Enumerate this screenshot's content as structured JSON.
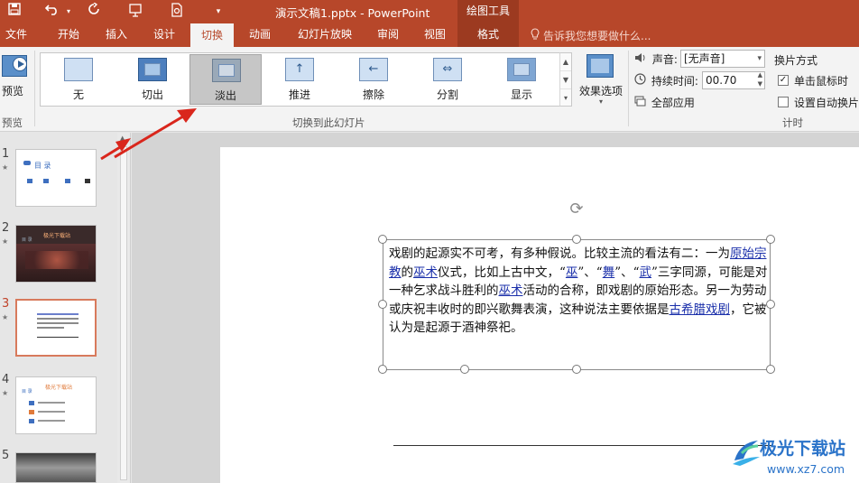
{
  "title_bar": {
    "document_title": "演示文稿1.pptx - PowerPoint",
    "context_label": "绘图工具",
    "icons": [
      "save-icon",
      "undo-icon",
      "redo-icon",
      "present-from-start-icon",
      "print-preview-icon",
      "customize-quick-access-icon"
    ]
  },
  "tabs": [
    {
      "label": "文件"
    },
    {
      "label": "开始"
    },
    {
      "label": "插入"
    },
    {
      "label": "设计"
    },
    {
      "label": "切换",
      "active": true
    },
    {
      "label": "动画"
    },
    {
      "label": "幻灯片放映"
    },
    {
      "label": "审阅"
    },
    {
      "label": "视图"
    },
    {
      "label": "格式",
      "contextual": true
    }
  ],
  "tell_me": "告诉我您想要做什么...",
  "ribbon": {
    "preview": {
      "button_label": "预览",
      "group_label": "预览"
    },
    "transitions_group_label": "切换到此幻灯片",
    "transitions": [
      {
        "label": "无"
      },
      {
        "label": "切出"
      },
      {
        "label": "淡出",
        "selected": true
      },
      {
        "label": "推进"
      },
      {
        "label": "擦除"
      },
      {
        "label": "分割"
      },
      {
        "label": "显示"
      }
    ],
    "effect_options_label": "效果选项",
    "timing": {
      "sound_label": "声音:",
      "sound_value": "[无声音]",
      "duration_label": "持续时间:",
      "duration_value": "00.70",
      "apply_all_label": "全部应用",
      "advance_heading": "换片方式",
      "on_click_label": "单击鼠标时",
      "on_click_checked": true,
      "auto_after_label": "设置自动换片时",
      "auto_after_checked": false,
      "group_label": "计时"
    }
  },
  "slides": [
    {
      "number": "1",
      "thumb_title": "目    录"
    },
    {
      "number": "2",
      "thumb_title": "极光下载站"
    },
    {
      "number": "3",
      "current": true
    },
    {
      "number": "4",
      "thumb_title": "极光下载站",
      "thumb_subtitle": "目 录"
    },
    {
      "number": "5"
    }
  ],
  "textbox": {
    "segments": [
      {
        "text": "戏剧的起源实不可考，有多种假说。比较主流的看法有二：一为"
      },
      {
        "text": "原始宗教",
        "link": true
      },
      {
        "text": "的"
      },
      {
        "text": "巫术",
        "link": true
      },
      {
        "text": "仪式，比如上古中文，“"
      },
      {
        "text": "巫",
        "link": true
      },
      {
        "text": "”、“"
      },
      {
        "text": "舞",
        "link": true
      },
      {
        "text": "”、“"
      },
      {
        "text": "武",
        "link": true
      },
      {
        "text": "”三字同源，可能是对一种乞求战斗胜利的"
      },
      {
        "text": "巫术",
        "link": true
      },
      {
        "text": "活动的合称，即戏剧的原始形态。另一为劳动或庆祝丰收时的即兴歌舞表演，这种说法主要依据是"
      },
      {
        "text": "古希腊戏剧",
        "link": true
      },
      {
        "text": "，它被认为是起源于酒神祭祀。"
      }
    ]
  },
  "watermark": {
    "title": "极光下载站",
    "url": "www.xz7.com"
  },
  "colors": {
    "accent": "#b7472a",
    "context_tab": "#9c3a20",
    "annotation_arrow": "#d9261c",
    "link": "#1a2faa"
  }
}
